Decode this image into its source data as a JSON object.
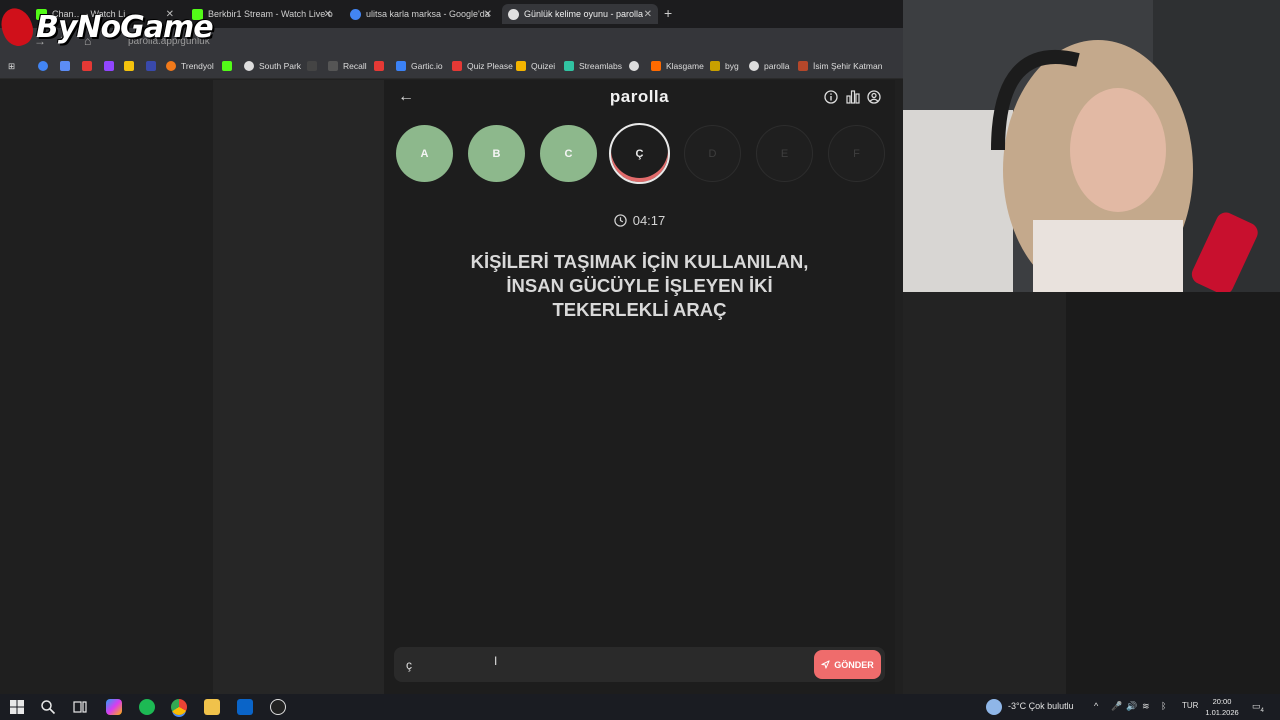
{
  "browser": {
    "tabs": [
      {
        "label": "Chan… - Watch Li…",
        "color": "#53fc18"
      },
      {
        "label": "Berkbir1 Stream - Watch Live o",
        "color": "#53fc18"
      },
      {
        "label": "ulitsa karla marksa - Google'da",
        "color": "#4285f4"
      },
      {
        "label": "Günlük kelime oyunu - parolla",
        "color": "#e0e0e0"
      }
    ],
    "url": "parolla.app/gunluk",
    "bookmarks": [
      {
        "label": "Trendyol",
        "color": "#f27a1a"
      },
      {
        "label": "South Park",
        "color": "#dddddd"
      },
      {
        "label": "Recall",
        "color": "#444444"
      },
      {
        "label": "Gartic.io",
        "color": "#3b82f6"
      },
      {
        "label": "Quiz Please",
        "color": "#e53935"
      },
      {
        "label": "Quizei",
        "color": "#f4b400"
      },
      {
        "label": "Streamlabs",
        "color": "#31c3a2"
      },
      {
        "label": "Klasgame",
        "color": "#ff6a00"
      },
      {
        "label": "byg",
        "color": "#c8a000"
      },
      {
        "label": "parolla",
        "color": "#dddddd"
      },
      {
        "label": "İsim Şehir Katman",
        "color": "#b4472a"
      }
    ]
  },
  "overlay": {
    "logo_text": "ByNoGame"
  },
  "app": {
    "brand": "parolla",
    "letters": [
      {
        "label": "A",
        "state": "done"
      },
      {
        "label": "B",
        "state": "done"
      },
      {
        "label": "C",
        "state": "done"
      },
      {
        "label": "Ç",
        "state": "current"
      },
      {
        "label": "D",
        "state": "pending"
      },
      {
        "label": "E",
        "state": "pending"
      },
      {
        "label": "F",
        "state": "pending"
      }
    ],
    "timer": "04:17",
    "question_lines": [
      "KİŞİLERİ TAŞIMAK İÇİN KULLANILAN,",
      "İNSAN GÜCÜYLE İŞLEYEN İKİ",
      "TEKERLEKLİ ARAÇ"
    ],
    "answer_value": "ç",
    "send_label": "GÖNDER",
    "colors": {
      "done": "#8db88c",
      "accent": "#ef6c6c"
    }
  },
  "taskbar": {
    "weather": "-3°C  Çok bulutlu",
    "lang": "TUR",
    "time": "20:00",
    "date": "1.01.2026",
    "notifications": "4"
  }
}
